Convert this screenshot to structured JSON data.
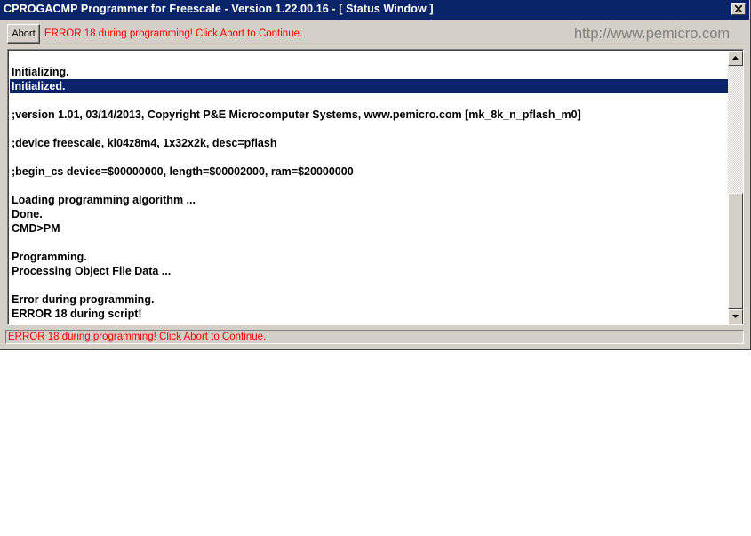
{
  "window": {
    "title": "CPROGACMP Programmer for Freescale - Version 1.22.00.16 - [ Status Window ]"
  },
  "toolbar": {
    "abort_label": "Abort",
    "message": "ERROR 18 during programming!  Click Abort to Continue.",
    "brand_url": "http://www.pemicro.com"
  },
  "log": {
    "selected_index": 1,
    "lines": [
      "Initializing.",
      "Initialized.",
      "",
      ";version 1.01, 03/14/2013, Copyright P&E Microcomputer Systems, www.pemicro.com [mk_8k_n_pflash_m0]",
      "",
      ";device freescale, kl04z8m4, 1x32x2k, desc=pflash",
      "",
      ";begin_cs device=$00000000, length=$00002000, ram=$20000000",
      "",
      "Loading programming algorithm ...",
      "Done.",
      "CMD>PM",
      "",
      "Programming.",
      "Processing Object File Data ...",
      "",
      "Error during programming.",
      "ERROR 18 during script!"
    ]
  },
  "statusbar": {
    "text": "ERROR 18 during programming!  Click Abort to Continue."
  },
  "icons": {
    "close": "close-icon",
    "scroll_up": "arrow-up-icon",
    "scroll_down": "arrow-down-icon"
  },
  "colors": {
    "titlebar": "#0a246a",
    "selection": "#0a246a",
    "error_text": "#ff0000",
    "brand_text": "#808080",
    "window_face": "#d4d0c8"
  }
}
